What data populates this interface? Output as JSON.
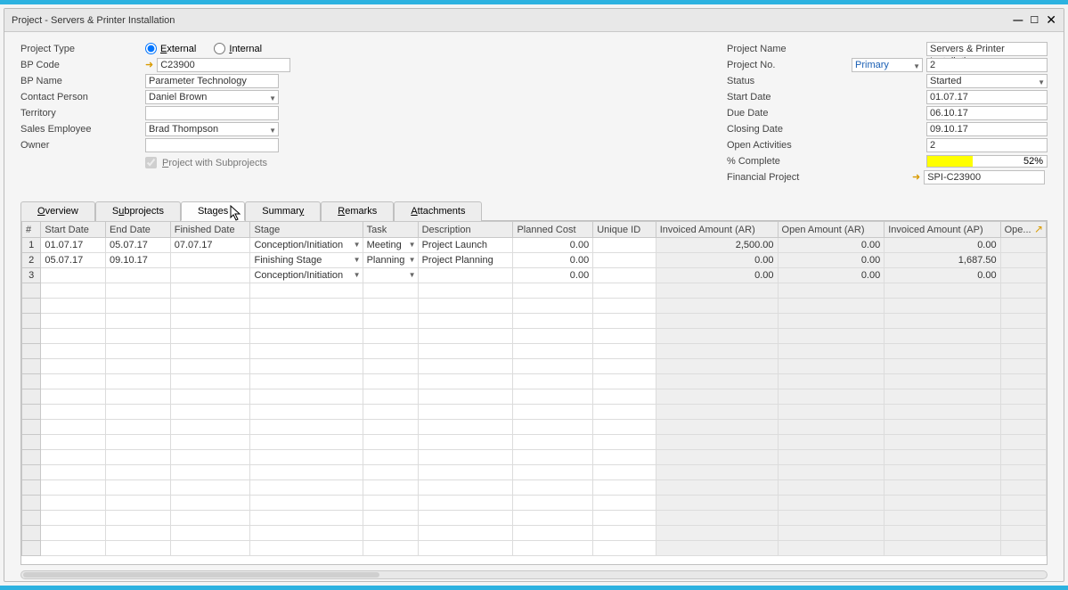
{
  "window": {
    "title": "Project - Servers & Printer Installation"
  },
  "left": {
    "projectTypeLabel": "Project Type",
    "external": "External",
    "internal": "Internal",
    "bpCodeLabel": "BP Code",
    "bpCode": "C23900",
    "bpNameLabel": "BP Name",
    "bpName": "Parameter Technology",
    "contactPersonLabel": "Contact Person",
    "contactPerson": "Daniel Brown",
    "territoryLabel": "Territory",
    "territory": "",
    "salesEmployeeLabel": "Sales Employee",
    "salesEmployee": "Brad Thompson",
    "ownerLabel": "Owner",
    "owner": "",
    "projectWithSub": "Project with Subprojects"
  },
  "right": {
    "projectNameLabel": "Project Name",
    "projectName": "Servers & Printer Installatio",
    "projectNoLabel": "Project No.",
    "projectNoType": "Primary",
    "projectNo": "2",
    "statusLabel": "Status",
    "status": "Started",
    "startDateLabel": "Start Date",
    "startDate": "01.07.17",
    "dueDateLabel": "Due Date",
    "dueDate": "06.10.17",
    "closingDateLabel": "Closing Date",
    "closingDate": "09.10.17",
    "openActivitiesLabel": "Open Activities",
    "openActivities": "2",
    "pctCompleteLabel": "% Complete",
    "pctComplete": "52%",
    "financialProjectLabel": "Financial Project",
    "financialProject": "SPI-C23900"
  },
  "tabs": {
    "overview": "Overview",
    "subprojects": "Subprojects",
    "stages": "Stages",
    "summary": "Summary",
    "remarks": "Remarks",
    "attachments": "Attachments"
  },
  "gridHeaders": {
    "num": "#",
    "startDate": "Start Date",
    "endDate": "End Date",
    "finishedDate": "Finished Date",
    "stage": "Stage",
    "task": "Task",
    "description": "Description",
    "plannedCost": "Planned Cost",
    "uniqueID": "Unique ID",
    "invoicedAR": "Invoiced Amount (AR)",
    "openAR": "Open Amount (AR)",
    "invoicedAP": "Invoiced Amount (AP)",
    "ope": "Ope..."
  },
  "gridRows": [
    {
      "n": "1",
      "start": "01.07.17",
      "end": "05.07.17",
      "finished": "07.07.17",
      "stage": "Conception/Initiation",
      "task": "Meeting",
      "desc": "Project Launch",
      "plan": "0.00",
      "uid": "",
      "invAR": "2,500.00",
      "openAR": "0.00",
      "invAP": "0.00"
    },
    {
      "n": "2",
      "start": "05.07.17",
      "end": "09.10.17",
      "finished": "",
      "stage": "Finishing Stage",
      "task": "Planning",
      "desc": "Project Planning",
      "plan": "0.00",
      "uid": "",
      "invAR": "0.00",
      "openAR": "0.00",
      "invAP": "1,687.50"
    },
    {
      "n": "3",
      "start": "",
      "end": "",
      "finished": "",
      "stage": "Conception/Initiation",
      "task": "",
      "desc": "",
      "plan": "0.00",
      "uid": "",
      "invAR": "0.00",
      "openAR": "0.00",
      "invAP": "0.00"
    }
  ]
}
